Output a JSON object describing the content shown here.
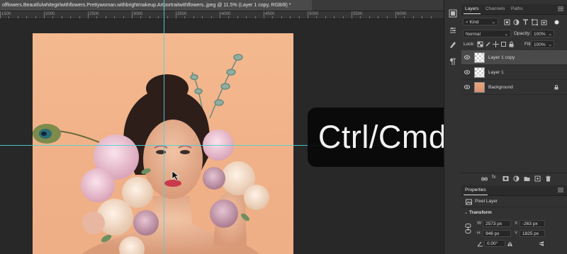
{
  "document": {
    "tab_title": "offlowers.Beautifulwhitegirlwithflowers.Prettywoman.withbrightmakeup.Artportraitwithflowers..jpeg @ 11.5% (Layer 1 copy, RGB/8) *",
    "close_icon": "close-icon"
  },
  "ruler": {
    "labels": [
      "1500",
      "2000",
      "2500",
      "3000",
      "3500",
      "4000",
      "4500",
      "5000",
      "5500",
      "6000"
    ]
  },
  "shortcut_overlay": {
    "text": "Ctrl/Cmd+J"
  },
  "layers_panel": {
    "tabs": [
      "Layers",
      "Channels",
      "Paths"
    ],
    "active_tab": "Layers",
    "filter_kind": "Kind",
    "blend_mode": "Normal",
    "opacity_label": "Opacity:",
    "opacity_value": "100%",
    "lock_label": "Lock:",
    "fill_label": "Fill:",
    "fill_value": "100%",
    "layers": [
      {
        "name": "Layer 1 copy",
        "selected": true,
        "thumb": "transparent"
      },
      {
        "name": "Layer 1",
        "selected": false,
        "thumb": "transparent"
      },
      {
        "name": "Background",
        "selected": false,
        "thumb": "photo",
        "locked": true
      }
    ]
  },
  "properties_panel": {
    "tab": "Properties",
    "kind": "Pixel Layer",
    "section": "Transform",
    "w_label": "W",
    "w_value": "2573 px",
    "h_label": "H",
    "h_value": "946 px",
    "x_label": "X",
    "x_value": "-263 px",
    "y_label": "Y",
    "y_value": "1825 px",
    "angle_value": "0.00°"
  },
  "colors": {
    "guide": "#4fd3d9",
    "backdrop": "#f2b48b",
    "panel_bg": "#323232",
    "selected_row": "#4a4a4a"
  }
}
